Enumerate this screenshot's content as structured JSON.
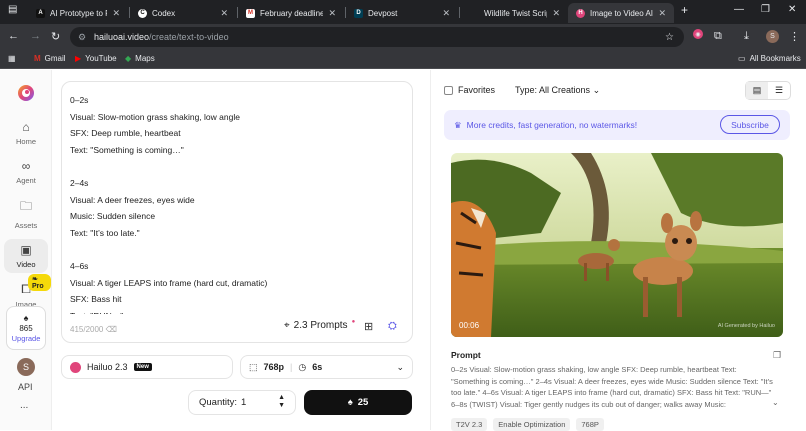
{
  "browser": {
    "tabs": [
      {
        "title": "AI Prototype to Prod",
        "favicon": "A"
      },
      {
        "title": "Codex",
        "favicon": "C"
      },
      {
        "title": "February deadlines a",
        "favicon": "M"
      },
      {
        "title": "Devpost",
        "favicon": "D"
      },
      {
        "title": "Wildlife Twist Script",
        "favicon": ""
      },
      {
        "title": "Image to Video AI Ge",
        "favicon": "H"
      }
    ],
    "url_host": "hailuoai.video",
    "url_path": "/create/text-to-video",
    "bookmarks": [
      "Gmail",
      "YouTube",
      "Maps"
    ],
    "all_bookmarks": "All Bookmarks",
    "profile_initial": "S"
  },
  "sidebar": {
    "items": [
      {
        "label": "Home",
        "icon": "home-icon"
      },
      {
        "label": "Agent",
        "icon": "infinity-icon"
      },
      {
        "label": "Assets",
        "icon": "folder-icon"
      },
      {
        "label": "Video",
        "icon": "video-icon"
      },
      {
        "label": "Image",
        "icon": "image-icon"
      }
    ],
    "pro_badge": "Pro",
    "credits": "865",
    "upgrade_label": "Upgrade",
    "avatar_initial": "S",
    "api_label": "API",
    "more": "..."
  },
  "editor": {
    "prompt_text": "0–2s\nVisual: Slow-motion grass shaking, low angle\nSFX: Deep rumble, heartbeat\nText: \"Something is coming…\"\n\n2–4s\nVisual: A deer freezes, eyes wide\nMusic: Sudden silence\nText: \"It’s too late.\"\n\n4–6s\nVisual: A tiger LEAPS into frame (hard cut, dramatic)\nSFX: Bass hit\nText: \"RUN—\"",
    "char_count": "415/2000",
    "prompts_label": "2.3 Prompts",
    "model": "Hailuo 2.3",
    "model_badge": "New",
    "resolution": "768p",
    "duration": "6s",
    "quantity_label": "Quantity:",
    "quantity_value": "1",
    "generate_cost": "25"
  },
  "results": {
    "favorites_label": "Favorites",
    "type_label": "Type:",
    "type_value": "All Creations",
    "banner_text": "More credits, fast generation, no watermarks!",
    "subscribe_label": "Subscribe",
    "video_duration": "00:06",
    "watermark": "AI Generated by Hailuo",
    "prompt_heading": "Prompt",
    "prompt_body": "0–2s Visual: Slow-motion grass shaking, low angle SFX: Deep rumble, heartbeat Text: \"Something is coming…\" 2–4s Visual: A deer freezes, eyes wide Music: Sudden silence Text: \"It’s too late.\" 4–6s Visual: A tiger LEAPS into frame (hard cut, dramatic) SFX: Bass hit Text: \"RUN—\" 6–8s (TWIST) Visual: Tiger gently nudges its cub out of danger; walks away Music:",
    "tags": [
      "T2V 2.3",
      "Enable Optimization",
      "768P"
    ]
  },
  "colors": {
    "accent": "#5b57e6",
    "chrome_dark": "#202124",
    "chrome_mid": "#35363a"
  }
}
